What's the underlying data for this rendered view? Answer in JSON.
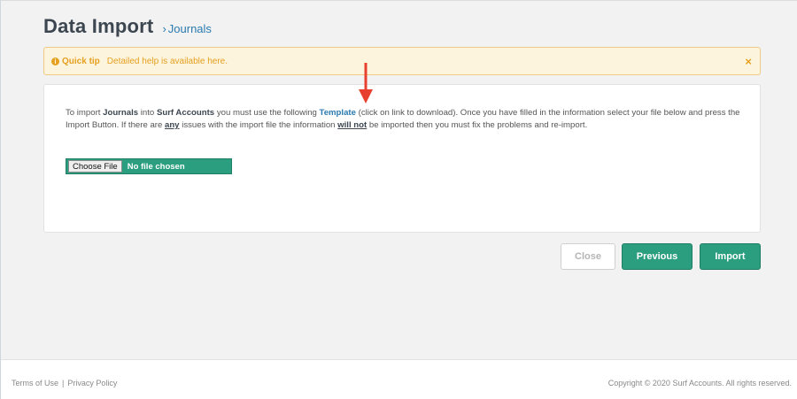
{
  "header": {
    "title": "Data Import",
    "breadcrumb_chevron": "›",
    "breadcrumb": "Journals"
  },
  "quick_tip": {
    "icon": "info-icon",
    "icon_glyph": "i",
    "title": "Quick tip",
    "text": "Detailed help is available here.",
    "close_glyph": "×"
  },
  "instructions": {
    "p1": "To import ",
    "b1": "Journals",
    "p2": " into ",
    "b2": "Surf Accounts",
    "p3": " you must use the following ",
    "template_link": "Template",
    "p4": " (click on link to download). Once you have filled in the information select your file below and press the Import Button. If there are ",
    "u1": "any",
    "p5": " issues with the import file the information ",
    "u2": "will not",
    "p6": " be imported then you must fix the problems and re-import."
  },
  "file_input": {
    "button_label": "Choose File",
    "status": "No file chosen"
  },
  "buttons": {
    "close": "Close",
    "previous": "Previous",
    "import": "Import"
  },
  "footer": {
    "terms": "Terms of Use",
    "separator": "|",
    "privacy": "Privacy Policy",
    "copyright": "Copyright © 2020 Surf Accounts. All rights reserved."
  },
  "colors": {
    "accent": "#2a9e7f",
    "link": "#2a7ab0",
    "tip_bg": "#fcf4dd",
    "tip_text": "#e6a020",
    "annotation_arrow": "#e8402f"
  }
}
